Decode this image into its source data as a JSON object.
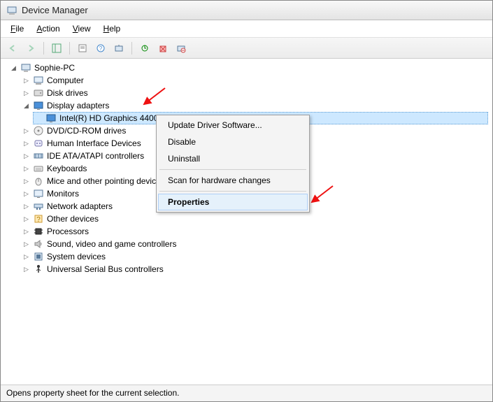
{
  "title": "Device Manager",
  "menubar": [
    "File",
    "Action",
    "View",
    "Help"
  ],
  "toolbar_icons": [
    "back",
    "forward",
    "show-hide-tree",
    "properties-sheet",
    "help",
    "scan",
    "update",
    "enable",
    "disable",
    "uninstall"
  ],
  "root_name": "Sophie-PC",
  "tree": [
    {
      "label": "Computer",
      "icon": "computer",
      "expanded": false
    },
    {
      "label": "Disk drives",
      "icon": "disk",
      "expanded": false
    },
    {
      "label": "Display adapters",
      "icon": "display",
      "expanded": true,
      "children": [
        {
          "label": "Intel(R) HD Graphics 4400",
          "icon": "display",
          "selected": true
        }
      ]
    },
    {
      "label": "DVD/CD-ROM drives",
      "icon": "cdrom",
      "expanded": false
    },
    {
      "label": "Human Interface Devices",
      "icon": "hid",
      "expanded": false
    },
    {
      "label": "IDE ATA/ATAPI controllers",
      "icon": "ide",
      "expanded": false
    },
    {
      "label": "Keyboards",
      "icon": "keyboard",
      "expanded": false
    },
    {
      "label": "Mice and other pointing devices",
      "icon": "mouse",
      "expanded": false
    },
    {
      "label": "Monitors",
      "icon": "monitor",
      "expanded": false
    },
    {
      "label": "Network adapters",
      "icon": "network",
      "expanded": false
    },
    {
      "label": "Other devices",
      "icon": "other",
      "expanded": false
    },
    {
      "label": "Processors",
      "icon": "processor",
      "expanded": false
    },
    {
      "label": "Sound, video and game controllers",
      "icon": "sound",
      "expanded": false
    },
    {
      "label": "System devices",
      "icon": "system",
      "expanded": false
    },
    {
      "label": "Universal Serial Bus controllers",
      "icon": "usb",
      "expanded": false
    }
  ],
  "context_menu": {
    "items": [
      "Update Driver Software...",
      "Disable",
      "Uninstall",
      "---",
      "Scan for hardware changes",
      "---",
      "Properties"
    ],
    "highlighted": "Properties"
  },
  "statusbar": "Opens property sheet for the current selection."
}
